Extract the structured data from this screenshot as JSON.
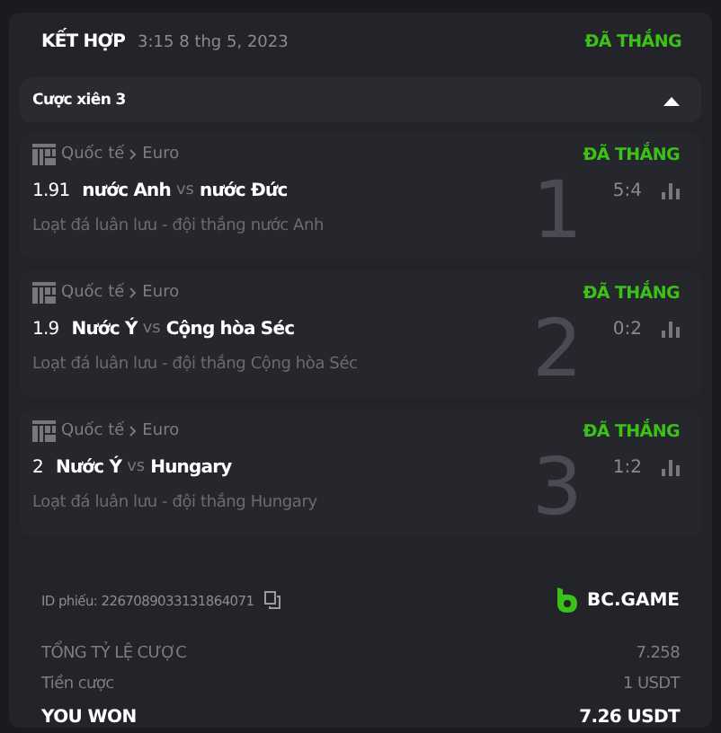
{
  "header": {
    "title": "KẾT HỢP",
    "datetime": "3:15 8 thg 5, 2023",
    "status": "ĐÃ THẮNG"
  },
  "parlay": {
    "label": "Cược xiên 3",
    "expanded": true
  },
  "legs": [
    {
      "league": "Quốc tế",
      "tournament": "Euro",
      "status": "ĐÃ THẮNG",
      "odds": "1.91",
      "home": "nước Anh",
      "vs": "vs",
      "away": "nước Đức",
      "score": "5:4",
      "market": "Loạt đá luân lưu - đội thắng nước Anh",
      "number": "1"
    },
    {
      "league": "Quốc tế",
      "tournament": "Euro",
      "status": "ĐÃ THẮNG",
      "odds": "1.9",
      "home": "Nước Ý",
      "vs": "vs",
      "away": "Cộng hòa Séc",
      "score": "0:2",
      "market": "Loạt đá luân lưu - đội thắng Cộng hòa Séc",
      "number": "2"
    },
    {
      "league": "Quốc tế",
      "tournament": "Euro",
      "status": "ĐÃ THẮNG",
      "odds": "2",
      "home": "Nước Ý",
      "vs": "vs",
      "away": "Hungary",
      "score": "1:2",
      "market": "Loạt đá luân lưu - đội thắng Hungary",
      "number": "3"
    }
  ],
  "ticket_id": "ID phiếu: 2267089033131864071",
  "brand": "BC.GAME",
  "summary": [
    {
      "kind": "muted",
      "label": "TỔNG TỶ LỆ CƯỢC",
      "value": "7.258"
    },
    {
      "kind": "muted",
      "label": "Tiền cược",
      "value": "1 USDT"
    },
    {
      "kind": "total",
      "label": "YOU WON",
      "value": "7.26 USDT"
    }
  ]
}
